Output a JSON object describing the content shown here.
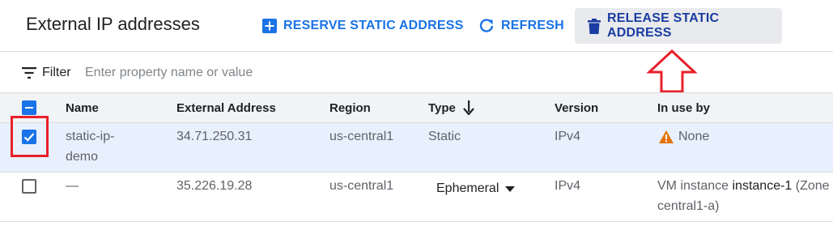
{
  "toolbar": {
    "title": "External IP addresses",
    "reserve_label": "RESERVE STATIC ADDRESS",
    "refresh_label": "REFRESH",
    "release_label": "RELEASE STATIC ADDRESS"
  },
  "filter": {
    "label": "Filter",
    "placeholder": "Enter property name or value"
  },
  "table": {
    "columns": {
      "name": "Name",
      "external_address": "External Address",
      "region": "Region",
      "type": "Type",
      "version": "Version",
      "in_use_by": "In use by"
    },
    "rows": [
      {
        "selected": true,
        "name_line1": "static-ip-",
        "name_line2": "demo",
        "external_address": "34.71.250.31",
        "region": "us-central1",
        "type": "Static",
        "version": "IPv4",
        "in_use_by": "None",
        "in_use_icon": "warning-icon"
      },
      {
        "selected": false,
        "name_line1": "—",
        "external_address": "35.226.19.28",
        "region": "us-central1",
        "type": "Ephemeral",
        "version": "IPv4",
        "in_use_prefix": "VM instance",
        "in_use_link": "instance-1",
        "in_use_suffix": "(Zone",
        "in_use_line2": "central1-a)"
      }
    ]
  },
  "colors": {
    "accent": "#1a73e8",
    "release_text": "#1a3da1",
    "selected_row": "#e8f0fe",
    "warning": "#e37400",
    "annotation_red": "#e8202a"
  }
}
